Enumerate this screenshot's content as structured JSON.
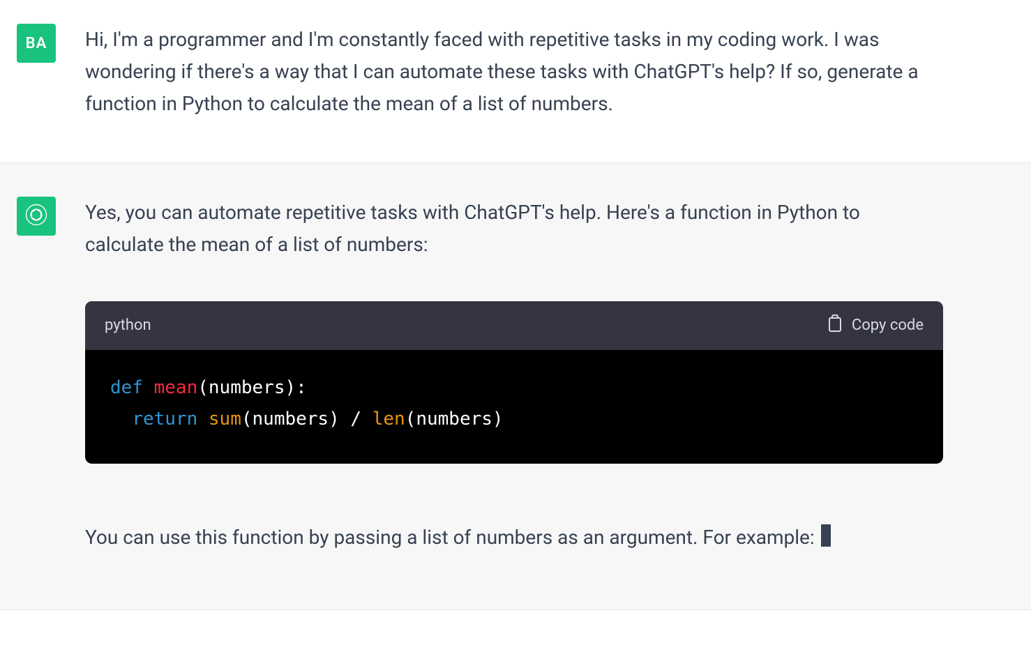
{
  "user": {
    "initials": "BA",
    "message": "Hi, I'm a programmer and I'm constantly faced with repetitive tasks in my coding work. I was wondering if there's a way that I can automate these tasks with ChatGPT's help? If so, generate a function in Python to calculate the mean of a list of numbers."
  },
  "assistant": {
    "intro": "Yes, you can automate repetitive tasks with ChatGPT's help. Here's a function in Python to calculate the mean of a list of numbers:",
    "code": {
      "language": "python",
      "copy_label": "Copy code",
      "tokens": {
        "def": "def",
        "fn_name": "mean",
        "sig_rest": "(numbers):",
        "return_kw": "return",
        "sum_bi": "sum",
        "after_sum": "(numbers) / ",
        "len_bi": "len",
        "after_len": "(numbers)"
      }
    },
    "follow": "You can use this function by passing a list of numbers as an argument. For example: "
  }
}
